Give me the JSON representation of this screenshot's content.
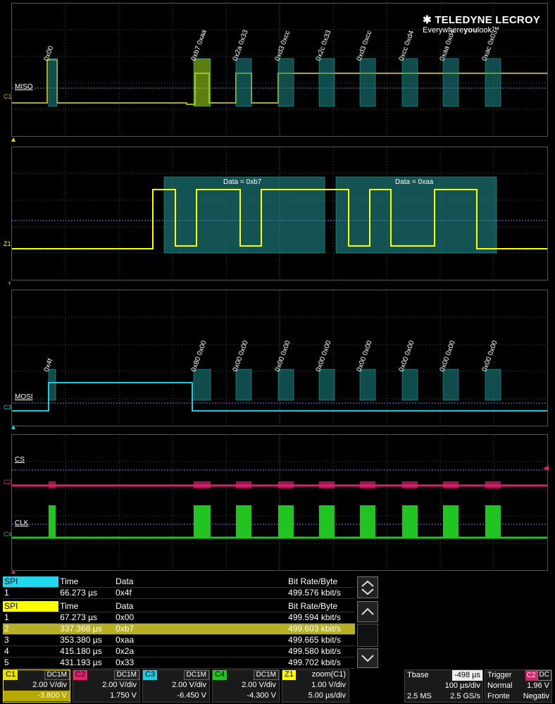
{
  "logo": {
    "brand": "TELEDYNE LECROY",
    "tagline_pre": "Everywhere",
    "tagline_bold": "you",
    "tagline_post": "look",
    "tm": "™"
  },
  "grid1": {
    "channel": "C1",
    "trace_label": "MISO",
    "trace_color": "#c7b400",
    "decode": [
      "0x00",
      "0xb7 0xaa",
      "0x2a 0x33",
      "0xd3 0xcc",
      "0x2c 0x33",
      "0xd3 0xcc",
      "0xcc 0xd4",
      "0xaa 0xd4",
      "0xac 0x03"
    ]
  },
  "grid2": {
    "channel": "Z1",
    "trace_color": "#ffff00",
    "bytes": [
      {
        "label": "Data = 0xb7"
      },
      {
        "label": "Data = 0xaa"
      }
    ]
  },
  "grid3": {
    "channel": "C3",
    "trace_label": "MOSI",
    "trace_color": "#22c9dd",
    "decode": [
      "0x4f",
      "0x80 0x00",
      "0x00 0x00",
      "0x00 0x00",
      "0x00 0x00",
      "0x00 0x00",
      "0x00 0x00",
      "0x00 0x00",
      "0x00 0x00"
    ]
  },
  "grid4": {
    "cs_label": "CS",
    "cs_channel": "C2",
    "cs_color": "#e0206e",
    "clk_label": "CLK",
    "clk_channel": "C4",
    "clk_color": "#22c422"
  },
  "table1": {
    "headers": [
      "SPI",
      "Time",
      "Data",
      "Bit Rate/Byte"
    ],
    "header_color": "#22d8ee",
    "rows": [
      [
        "1",
        "66.273 µs",
        "0x4f",
        "499.576 kbit/s"
      ]
    ]
  },
  "table2": {
    "headers": [
      "SPI",
      "Time",
      "Data",
      "Bit Rate/Byte"
    ],
    "header_color": "#ffff00",
    "rows": [
      [
        "1",
        "67.273 µs",
        "0x00",
        "499.594 kbit/s"
      ],
      [
        "2",
        "337.368 µs",
        "0xb7",
        "499.603 kbit/s"
      ],
      [
        "3",
        "353.380 µs",
        "0xaa",
        "499.665 kbit/s"
      ],
      [
        "4",
        "415.180 µs",
        "0x2a",
        "499.580 kbit/s"
      ],
      [
        "5",
        "431.193 µs",
        "0x33",
        "499.702 kbit/s"
      ]
    ],
    "selected_row": 1
  },
  "descriptors": [
    {
      "tag": "C1",
      "coupling": "DC1M",
      "vdiv": "2.00 V/div",
      "offset": "-3.800 V",
      "color": "#e8e000"
    },
    {
      "tag": "C2",
      "coupling": "DC1M",
      "vdiv": "2.00 V/div",
      "offset": "1.750 V",
      "color": "#e0206e"
    },
    {
      "tag": "C3",
      "coupling": "DC1M",
      "vdiv": "2.00 V/div",
      "offset": "-6.450 V",
      "color": "#22c9dd"
    },
    {
      "tag": "C4",
      "coupling": "DC1M",
      "vdiv": "2.00 V/div",
      "offset": "-4.300 V",
      "color": "#22c422"
    },
    {
      "tag": "Z1",
      "coupling": "zoom(C1)",
      "vdiv": "1.00 V/div",
      "offset": "5.00 µs/div",
      "color": "#ffff00"
    }
  ],
  "timebase": {
    "label": "Tbase",
    "delay": "-498 µs",
    "tdiv": "100 µs/div",
    "samples": "2.5 MS",
    "rate": "2.5 GS/s"
  },
  "trigger": {
    "label": "Trigger",
    "source": "C2",
    "coupling": "DC",
    "mode": "Normal",
    "level": "1.96 V",
    "edge": "Fronte",
    "slope": "Negativ"
  }
}
